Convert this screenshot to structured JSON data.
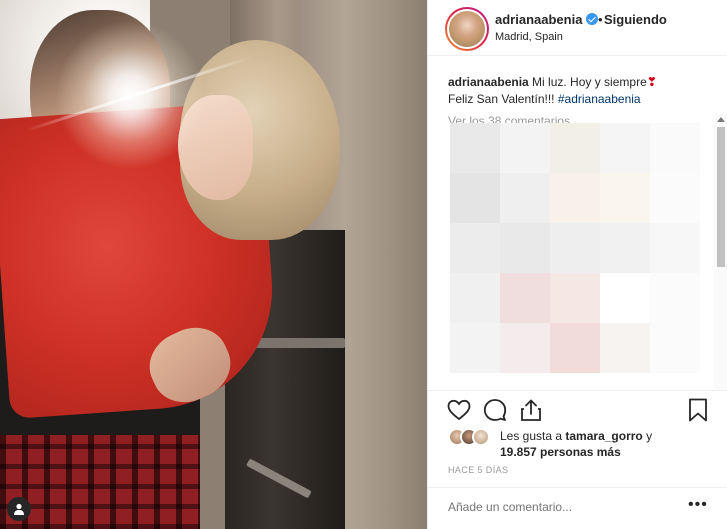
{
  "post": {
    "username": "adrianaabenia",
    "follow_label": "Siguiendo",
    "separator": "•",
    "location": "Madrid, Spain"
  },
  "caption": {
    "username": "adrianaabenia",
    "text_1": "Mi luz. Hoy y siempre",
    "heart": "❣",
    "text_2": "Feliz San Valentín!!!",
    "hashtag": "#adrianaabenia"
  },
  "view_more": "Ver los 38 comentarios",
  "likes": {
    "prefix": "Les gusta a",
    "user": "tamara_gorro",
    "conjunction": "y",
    "count": "19.857 personas más"
  },
  "timestamp": "HACE 5 DÍAS",
  "comment_input": {
    "placeholder": "Añade un comentario..."
  },
  "more_label": "•••",
  "icons": {
    "like": "heart-icon",
    "comment": "comment-icon",
    "share": "share-icon",
    "save": "bookmark-icon",
    "verified": "verified-badge-icon",
    "profile": "user-icon"
  },
  "colors": {
    "text": "#262626",
    "muted": "#999999",
    "verified": "#3897f0",
    "hashtag": "#003569",
    "heart": "#d0021b"
  }
}
